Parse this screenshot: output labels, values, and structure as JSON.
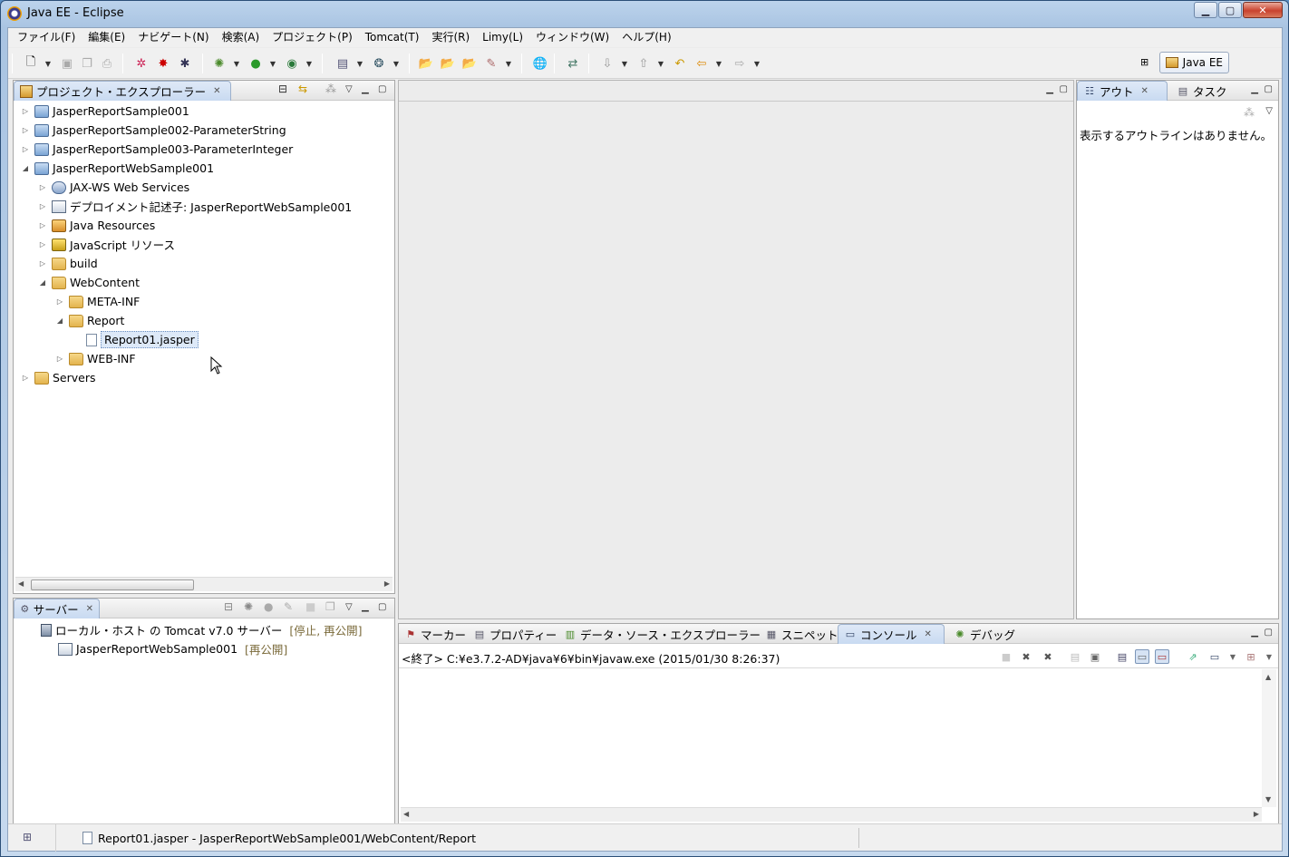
{
  "window": {
    "title": "Java EE - Eclipse"
  },
  "menu": [
    "ファイル(F)",
    "編集(E)",
    "ナビゲート(N)",
    "検索(A)",
    "プロジェクト(P)",
    "Tomcat(T)",
    "実行(R)",
    "Limy(L)",
    "ウィンドウ(W)",
    "ヘルプ(H)"
  ],
  "perspective": {
    "label": "Java EE"
  },
  "project_explorer": {
    "title": "プロジェクト・エクスプローラー",
    "items": [
      {
        "label": "JasperReportSample001",
        "level": 0,
        "expanded": false,
        "icon": "project-icon"
      },
      {
        "label": "JasperReportSample002-ParameterString",
        "level": 0,
        "expanded": false,
        "icon": "project-icon"
      },
      {
        "label": "JasperReportSample003-ParameterInteger",
        "level": 0,
        "expanded": false,
        "icon": "project-icon"
      },
      {
        "label": "JasperReportWebSample001",
        "level": 0,
        "expanded": true,
        "icon": "web-project-icon"
      },
      {
        "label": "JAX-WS Web Services",
        "level": 1,
        "expanded": false,
        "icon": "web-services-icon"
      },
      {
        "label": "デプロイメント記述子: JasperReportWebSample001",
        "level": 1,
        "expanded": false,
        "icon": "deployment-descriptor-icon"
      },
      {
        "label": "Java Resources",
        "level": 1,
        "expanded": false,
        "icon": "java-resources-icon"
      },
      {
        "label": "JavaScript リソース",
        "level": 1,
        "expanded": false,
        "icon": "javascript-resources-icon"
      },
      {
        "label": "build",
        "level": 1,
        "expanded": false,
        "icon": "folder-icon"
      },
      {
        "label": "WebContent",
        "level": 1,
        "expanded": true,
        "icon": "folder-icon"
      },
      {
        "label": "META-INF",
        "level": 2,
        "expanded": false,
        "icon": "folder-icon"
      },
      {
        "label": "Report",
        "level": 2,
        "expanded": true,
        "icon": "folder-icon"
      },
      {
        "label": "Report01.jasper",
        "level": 3,
        "expanded": null,
        "icon": "file-icon",
        "selected": true
      },
      {
        "label": "WEB-INF",
        "level": 2,
        "expanded": false,
        "icon": "folder-icon"
      },
      {
        "label": "Servers",
        "level": 0,
        "expanded": false,
        "icon": "project-icon"
      }
    ]
  },
  "outline": {
    "tabs": [
      "アウト",
      "タスク"
    ],
    "message": "表示するアウトラインはありません。"
  },
  "servers": {
    "title": "サーバー",
    "items": [
      {
        "label": "ローカル・ホスト の Tomcat v7.0 サーバー",
        "state": "[停止, 再公開]"
      },
      {
        "label": "JasperReportWebSample001",
        "state": "[再公開]"
      }
    ]
  },
  "bottom_tabs": [
    "マーカー",
    "プロパティー",
    "データ・ソース・エクスプローラー",
    "スニペット",
    "コンソール",
    "デバッグ"
  ],
  "console": {
    "header": "<終了> C:¥e3.7.2-AD¥java¥6¥bin¥javaw.exe (2015/01/30 8:26:37)"
  },
  "status_bar": {
    "text": "Report01.jasper - JasperReportWebSample001/WebContent/Report"
  },
  "colors": {
    "selection": "#dde9f8",
    "server_state": "#7a6a3a",
    "title_bar": "#bcd3ec"
  }
}
